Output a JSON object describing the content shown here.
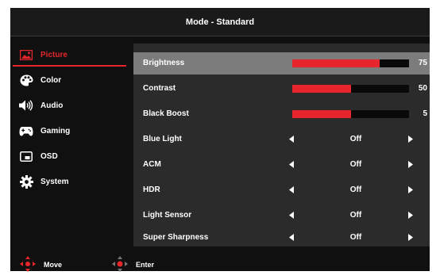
{
  "header": {
    "title": "Mode - Standard"
  },
  "sidebar": {
    "items": [
      {
        "label": "Picture",
        "icon": "picture-icon",
        "active": true
      },
      {
        "label": "Color",
        "icon": "palette-icon",
        "active": false
      },
      {
        "label": "Audio",
        "icon": "speaker-icon",
        "active": false
      },
      {
        "label": "Gaming",
        "icon": "gamepad-icon",
        "active": false
      },
      {
        "label": "OSD",
        "icon": "osd-window-icon",
        "active": false
      },
      {
        "label": "System",
        "icon": "gear-icon",
        "active": false
      }
    ]
  },
  "settings": [
    {
      "label": "Brightness",
      "type": "slider",
      "value": "75",
      "level": 0.75,
      "selected": true
    },
    {
      "label": "Contrast",
      "type": "slider",
      "value": "50",
      "level": 0.5,
      "selected": false
    },
    {
      "label": "Black Boost",
      "type": "slider",
      "value": "5",
      "level": 0.5,
      "selected": false
    },
    {
      "label": "Blue Light",
      "type": "option",
      "value": "Off"
    },
    {
      "label": "ACM",
      "type": "option",
      "value": "Off"
    },
    {
      "label": "HDR",
      "type": "option",
      "value": "Off"
    },
    {
      "label": "Light Sensor",
      "type": "option",
      "value": "Off"
    },
    {
      "label": "Super Sharpness",
      "type": "option",
      "value": "Off"
    }
  ],
  "footer": {
    "move_label": "Move",
    "enter_label": "Enter"
  },
  "colors": {
    "accent": "#e6262b",
    "background": "#101010",
    "panel": "#2b2b2b",
    "selected_row": "#7c7c7c"
  }
}
